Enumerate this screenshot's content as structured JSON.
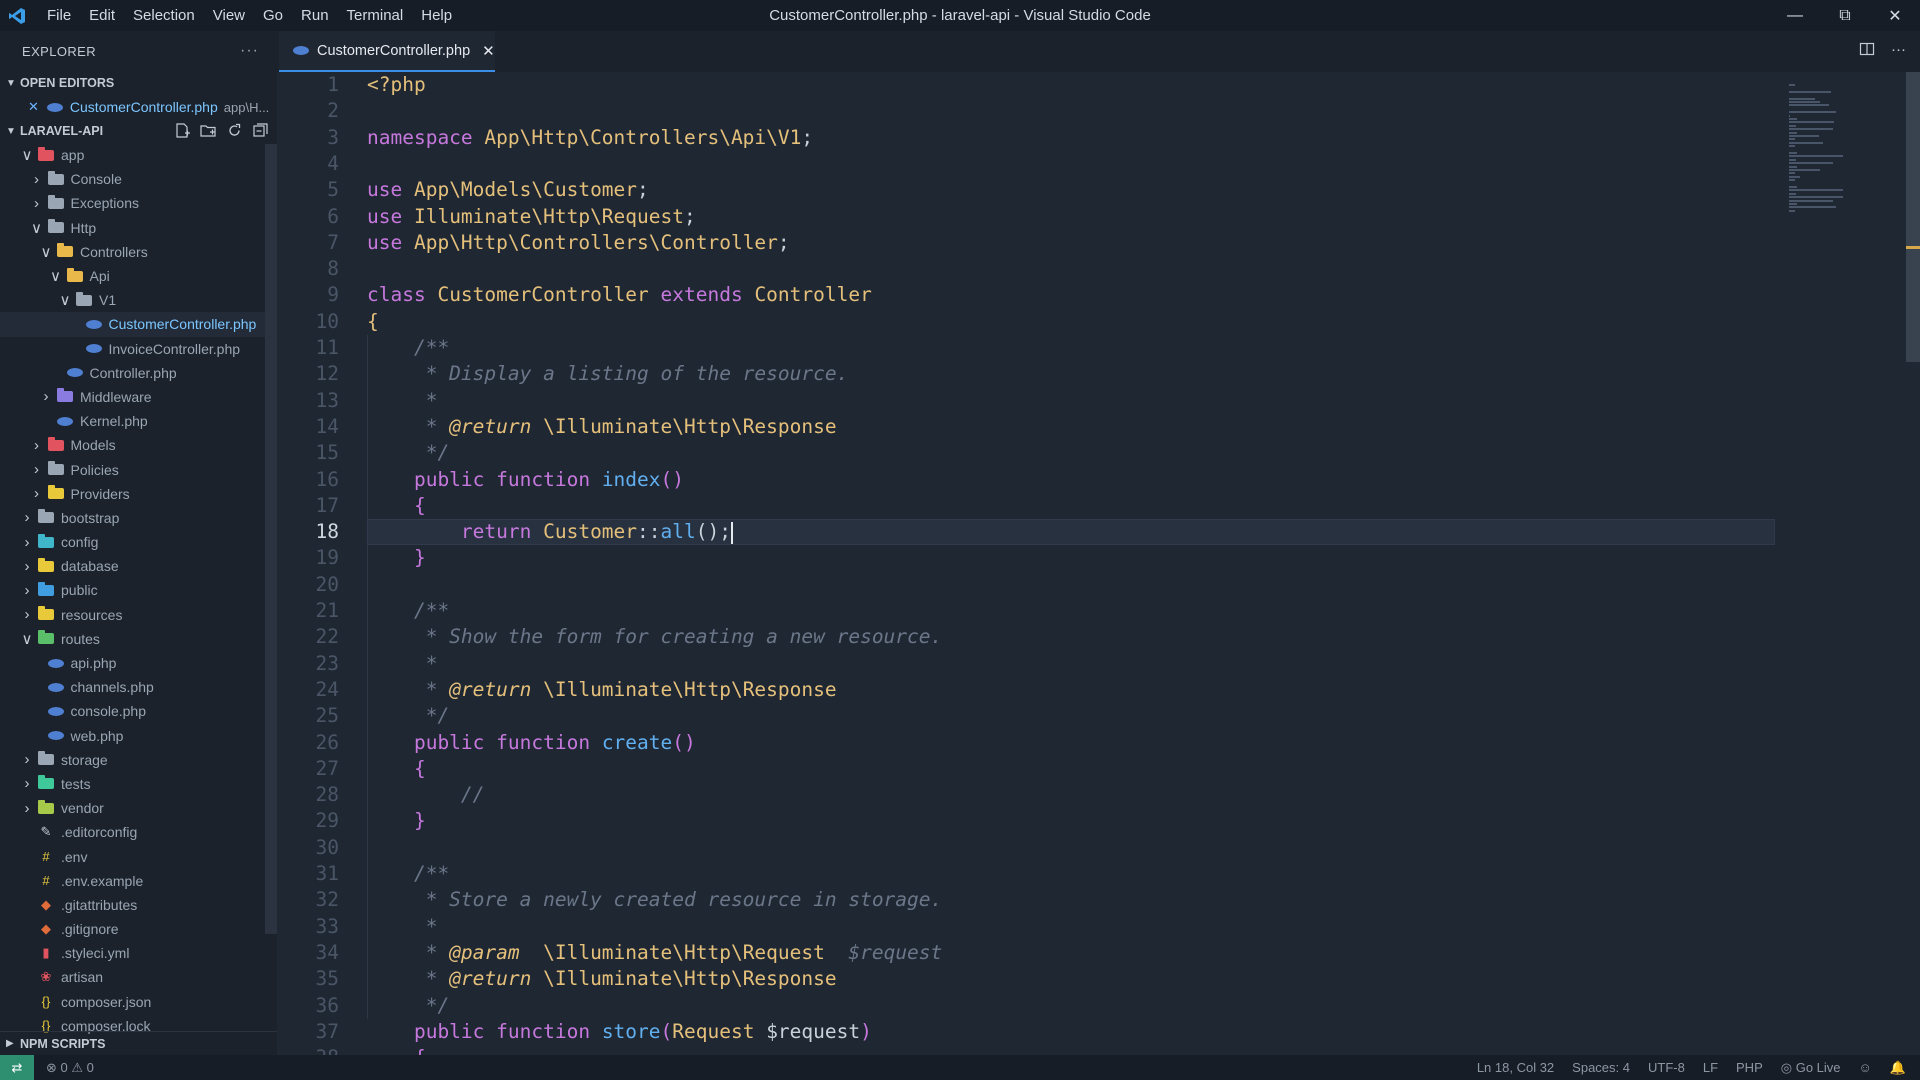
{
  "window": {
    "title": "CustomerController.php - laravel-api - Visual Studio Code",
    "menu": [
      "File",
      "Edit",
      "Selection",
      "View",
      "Go",
      "Run",
      "Terminal",
      "Help"
    ]
  },
  "sidebar": {
    "header": "EXPLORER",
    "open_editors_title": "OPEN EDITORS",
    "open_editor": {
      "name": "CustomerController.php",
      "path": "app\\H..."
    },
    "project_title": "LARAVEL-API",
    "tree": [
      {
        "label": "app",
        "depth": 0,
        "kind": "folder",
        "open": true,
        "color": "#e0535f"
      },
      {
        "label": "Console",
        "depth": 1,
        "kind": "folder",
        "open": false,
        "color": "#9aa6b3"
      },
      {
        "label": "Exceptions",
        "depth": 1,
        "kind": "folder",
        "open": false,
        "color": "#9aa6b3"
      },
      {
        "label": "Http",
        "depth": 1,
        "kind": "folder",
        "open": true,
        "color": "#9aa6b3"
      },
      {
        "label": "Controllers",
        "depth": 2,
        "kind": "folder",
        "open": true,
        "color": "#e8b94a"
      },
      {
        "label": "Api",
        "depth": 3,
        "kind": "folder",
        "open": true,
        "color": "#e8b94a"
      },
      {
        "label": "V1",
        "depth": 4,
        "kind": "folder",
        "open": true,
        "color": "#9aa6b3"
      },
      {
        "label": "CustomerController.php",
        "depth": 5,
        "kind": "php",
        "selected": true
      },
      {
        "label": "InvoiceController.php",
        "depth": 5,
        "kind": "php"
      },
      {
        "label": "Controller.php",
        "depth": 3,
        "kind": "php"
      },
      {
        "label": "Middleware",
        "depth": 2,
        "kind": "folder",
        "open": false,
        "color": "#8a7be0"
      },
      {
        "label": "Kernel.php",
        "depth": 2,
        "kind": "php"
      },
      {
        "label": "Models",
        "depth": 1,
        "kind": "folder",
        "open": false,
        "color": "#e0535f"
      },
      {
        "label": "Policies",
        "depth": 1,
        "kind": "folder",
        "open": false,
        "color": "#9aa6b3"
      },
      {
        "label": "Providers",
        "depth": 1,
        "kind": "folder",
        "open": false,
        "color": "#e8c93a"
      },
      {
        "label": "bootstrap",
        "depth": 0,
        "kind": "folder",
        "open": false,
        "color": "#9aa6b3"
      },
      {
        "label": "config",
        "depth": 0,
        "kind": "folder",
        "open": false,
        "color": "#3fb6c9"
      },
      {
        "label": "database",
        "depth": 0,
        "kind": "folder",
        "open": false,
        "color": "#e8c93a"
      },
      {
        "label": "public",
        "depth": 0,
        "kind": "folder",
        "open": false,
        "color": "#3f9de0"
      },
      {
        "label": "resources",
        "depth": 0,
        "kind": "folder",
        "open": false,
        "color": "#e8c93a"
      },
      {
        "label": "routes",
        "depth": 0,
        "kind": "folder",
        "open": true,
        "color": "#5bbf6a"
      },
      {
        "label": "api.php",
        "depth": 1,
        "kind": "php"
      },
      {
        "label": "channels.php",
        "depth": 1,
        "kind": "php"
      },
      {
        "label": "console.php",
        "depth": 1,
        "kind": "php"
      },
      {
        "label": "web.php",
        "depth": 1,
        "kind": "php"
      },
      {
        "label": "storage",
        "depth": 0,
        "kind": "folder",
        "open": false,
        "color": "#9aa6b3"
      },
      {
        "label": "tests",
        "depth": 0,
        "kind": "folder",
        "open": false,
        "color": "#3fc99b"
      },
      {
        "label": "vendor",
        "depth": 0,
        "kind": "folder",
        "open": false,
        "color": "#a6c94a"
      },
      {
        "label": ".editorconfig",
        "depth": 0,
        "kind": "glyph",
        "glyph": "✎",
        "color": "#c5cbd3"
      },
      {
        "label": ".env",
        "depth": 0,
        "kind": "glyph",
        "glyph": "#",
        "color": "#e8c93a"
      },
      {
        "label": ".env.example",
        "depth": 0,
        "kind": "glyph",
        "glyph": "#",
        "color": "#e8c93a"
      },
      {
        "label": ".gitattributes",
        "depth": 0,
        "kind": "glyph",
        "glyph": "◆",
        "color": "#e06c3a"
      },
      {
        "label": ".gitignore",
        "depth": 0,
        "kind": "glyph",
        "glyph": "◆",
        "color": "#e06c3a"
      },
      {
        "label": ".styleci.yml",
        "depth": 0,
        "kind": "glyph",
        "glyph": "▮",
        "color": "#e0535f"
      },
      {
        "label": "artisan",
        "depth": 0,
        "kind": "glyph",
        "glyph": "❀",
        "color": "#e0535f"
      },
      {
        "label": "composer.json",
        "depth": 0,
        "kind": "glyph",
        "glyph": "{}",
        "color": "#e8c93a"
      },
      {
        "label": "composer.lock",
        "depth": 0,
        "kind": "glyph",
        "glyph": "{}",
        "color": "#e8c93a"
      }
    ],
    "npm_title": "NPM SCRIPTS"
  },
  "editor": {
    "tab_label": "CustomerController.php",
    "current_line": 18,
    "lines": [
      [
        [
          "t",
          "<?php"
        ]
      ],
      [],
      [
        [
          "k",
          "namespace "
        ],
        [
          "t",
          "App\\Http\\Controllers\\Api\\V1"
        ],
        [
          "p",
          ";"
        ]
      ],
      [],
      [
        [
          "k",
          "use "
        ],
        [
          "t",
          "App\\Models\\Customer"
        ],
        [
          "p",
          ";"
        ]
      ],
      [
        [
          "k",
          "use "
        ],
        [
          "t",
          "Illuminate\\Http\\Request"
        ],
        [
          "p",
          ";"
        ]
      ],
      [
        [
          "k",
          "use "
        ],
        [
          "t",
          "App\\Http\\Controllers\\Controller"
        ],
        [
          "p",
          ";"
        ]
      ],
      [],
      [
        [
          "k",
          "class "
        ],
        [
          "t",
          "CustomerController "
        ],
        [
          "k",
          "extends "
        ],
        [
          "t",
          "Controller"
        ]
      ],
      [
        [
          "br2",
          "{"
        ]
      ],
      [
        [
          "c",
          "    /**"
        ]
      ],
      [
        [
          "c",
          "     * Display a listing of the resource."
        ]
      ],
      [
        [
          "c",
          "     *"
        ]
      ],
      [
        [
          "c",
          "     * "
        ],
        [
          "ca",
          "@return "
        ],
        [
          "t",
          "\\Illuminate\\Http\\Response"
        ]
      ],
      [
        [
          "c",
          "     */"
        ]
      ],
      [
        [
          "k",
          "    public function "
        ],
        [
          "f",
          "index"
        ],
        [
          "br",
          "()"
        ]
      ],
      [
        [
          "br",
          "    {"
        ]
      ],
      [
        [
          "kb",
          "        return "
        ],
        [
          "t",
          "Customer"
        ],
        [
          "p",
          "::"
        ],
        [
          "f",
          "all"
        ],
        [
          "p",
          "();"
        ]
      ],
      [
        [
          "br",
          "    }"
        ]
      ],
      [],
      [
        [
          "c",
          "    /**"
        ]
      ],
      [
        [
          "c",
          "     * Show the form for creating a new resource."
        ]
      ],
      [
        [
          "c",
          "     *"
        ]
      ],
      [
        [
          "c",
          "     * "
        ],
        [
          "ca",
          "@return "
        ],
        [
          "t",
          "\\Illuminate\\Http\\Response"
        ]
      ],
      [
        [
          "c",
          "     */"
        ]
      ],
      [
        [
          "k",
          "    public function "
        ],
        [
          "f",
          "create"
        ],
        [
          "br",
          "()"
        ]
      ],
      [
        [
          "br",
          "    {"
        ]
      ],
      [
        [
          "c",
          "        //"
        ]
      ],
      [
        [
          "br",
          "    }"
        ]
      ],
      [],
      [
        [
          "c",
          "    /**"
        ]
      ],
      [
        [
          "c",
          "     * Store a newly created resource in storage."
        ]
      ],
      [
        [
          "c",
          "     *"
        ]
      ],
      [
        [
          "c",
          "     * "
        ],
        [
          "ca",
          "@param  "
        ],
        [
          "t",
          "\\Illuminate\\Http\\Request  "
        ],
        [
          "cv",
          "$request"
        ]
      ],
      [
        [
          "c",
          "     * "
        ],
        [
          "ca",
          "@return "
        ],
        [
          "t",
          "\\Illuminate\\Http\\Response"
        ]
      ],
      [
        [
          "c",
          "     */"
        ]
      ],
      [
        [
          "k",
          "    public function "
        ],
        [
          "f",
          "store"
        ],
        [
          "br",
          "("
        ],
        [
          "t",
          "Request "
        ],
        [
          "p",
          "$request"
        ],
        [
          "br",
          ")"
        ]
      ],
      [
        [
          "br",
          "    {"
        ]
      ]
    ]
  },
  "statusbar": {
    "problems": "⊗ 0 ⚠ 0",
    "position": "Ln 18, Col 32",
    "spaces": "Spaces: 4",
    "encoding": "UTF-8",
    "eol": "LF",
    "language": "PHP",
    "golive": "Go Live"
  }
}
